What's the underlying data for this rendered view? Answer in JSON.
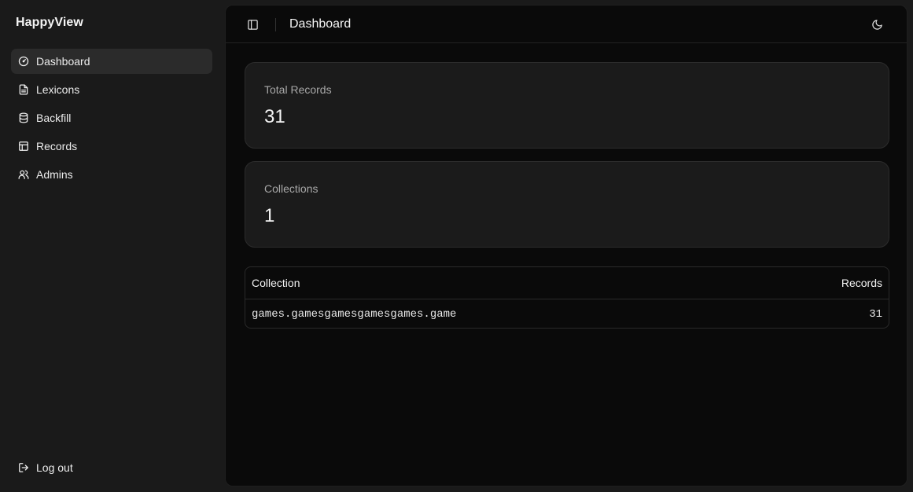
{
  "sidebar": {
    "brand": "HappyView",
    "items": [
      {
        "label": "Dashboard",
        "icon": "gauge-icon",
        "active": true
      },
      {
        "label": "Lexicons",
        "icon": "file-text-icon"
      },
      {
        "label": "Backfill",
        "icon": "database-icon"
      },
      {
        "label": "Records",
        "icon": "table-icon"
      },
      {
        "label": "Admins",
        "icon": "users-icon"
      }
    ],
    "logout": {
      "label": "Log out",
      "icon": "log-out-icon"
    }
  },
  "header": {
    "title": "Dashboard",
    "sidebar_toggle_icon": "panel-left-icon",
    "theme_toggle_icon": "moon-icon"
  },
  "stats": [
    {
      "label": "Total Records",
      "value": "31"
    },
    {
      "label": "Collections",
      "value": "1"
    }
  ],
  "table": {
    "columns": [
      "Collection",
      "Records"
    ],
    "rows": [
      {
        "collection": "games.gamesgamesgamesgames.game",
        "records": "31"
      }
    ]
  },
  "colors": {
    "sidebar_bg": "#1a1a1a",
    "main_bg": "#0a0a0a",
    "card_bg": "#1b1b1b",
    "active_item_bg": "#2b2b2b"
  }
}
